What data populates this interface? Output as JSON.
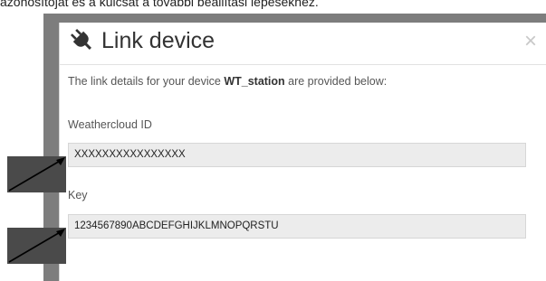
{
  "caption": "azonosítóját és a kulcsát a további beállítási lépésekhez.",
  "dialog": {
    "title": "Link device",
    "close_symbol": "×",
    "icon": "plug-icon",
    "intro_prefix": "The link details for your device ",
    "device_name": "WT_station",
    "intro_suffix": " are provided below:",
    "fields": {
      "weathercloud_id_label": "Weathercloud ID",
      "weathercloud_id_value": "XXXXXXXXXXXXXXXX",
      "key_label": "Key",
      "key_value": "1234567890ABCDEFGHIJKLMNOPQRSTU"
    }
  },
  "colors": {
    "frame": "#7d7d7d",
    "field_bg": "#ececec",
    "arrow_bg": "#4a4a4a"
  }
}
